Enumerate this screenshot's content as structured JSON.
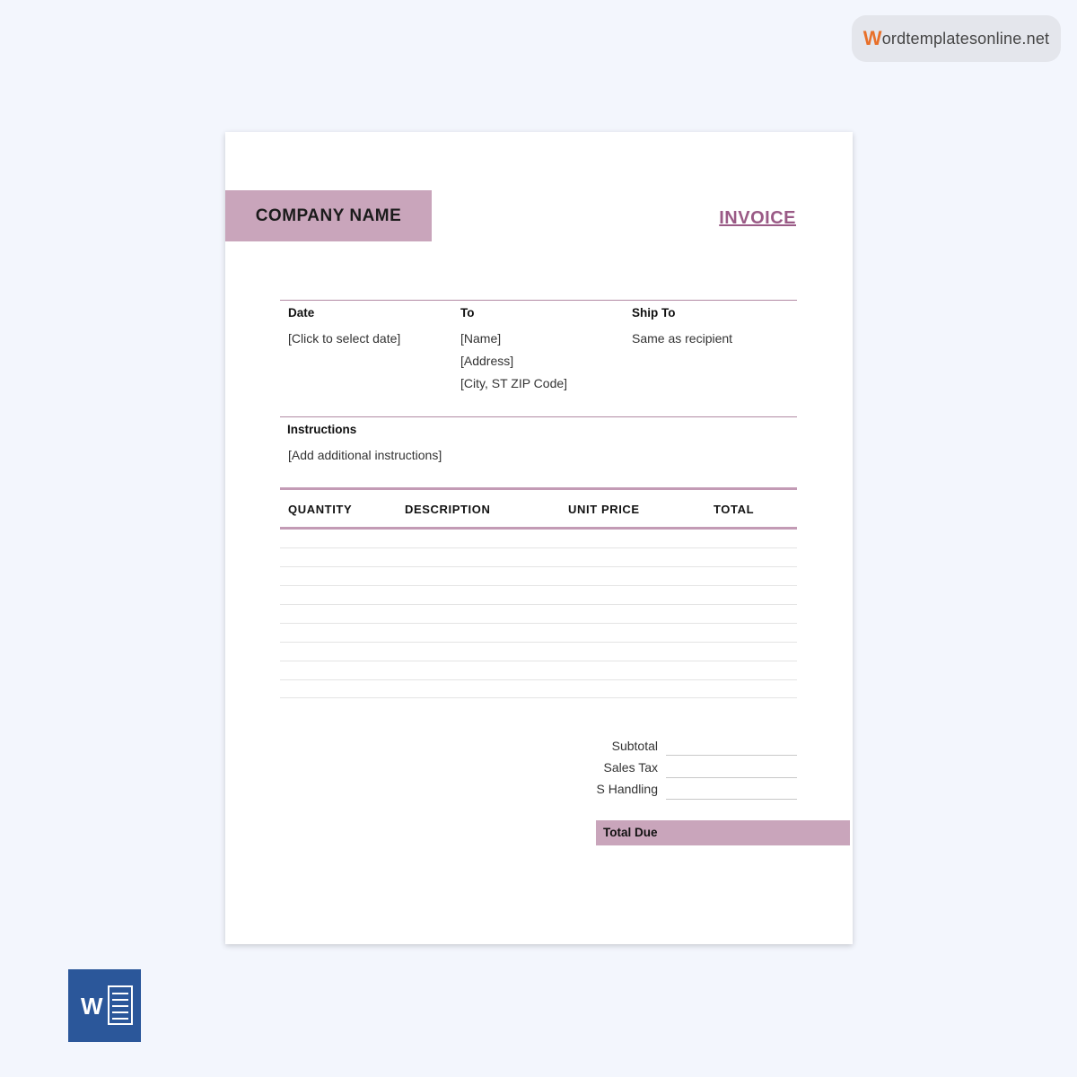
{
  "brand": {
    "initial": "W",
    "rest": "ordtemplatesonline.net"
  },
  "invoice": {
    "company_name": "COMPANY NAME",
    "title": "INVOICE",
    "date_label": "Date",
    "date_value": "[Click to select date]",
    "to_label": "To",
    "to_name": "[Name]",
    "to_address": "[Address]",
    "to_city": "[City, ST  ZIP Code]",
    "ship_label": "Ship To",
    "ship_value": "Same as recipient",
    "instructions_label": "Instructions",
    "instructions_value": "[Add additional instructions]",
    "columns": [
      "QUANTITY",
      "DESCRIPTION",
      "UNIT PRICE",
      "TOTAL"
    ],
    "subtotal_label": "Subtotal",
    "sales_tax_label": "Sales Tax",
    "handling_label": "S Handling",
    "total_due_label": "Total Due"
  },
  "icons": {
    "app": "word-icon",
    "app_letter": "W"
  },
  "colors": {
    "accent": "#c9a5bb",
    "title": "#9a5a86",
    "background": "#f3f6fd",
    "word_blue": "#2b579a"
  }
}
